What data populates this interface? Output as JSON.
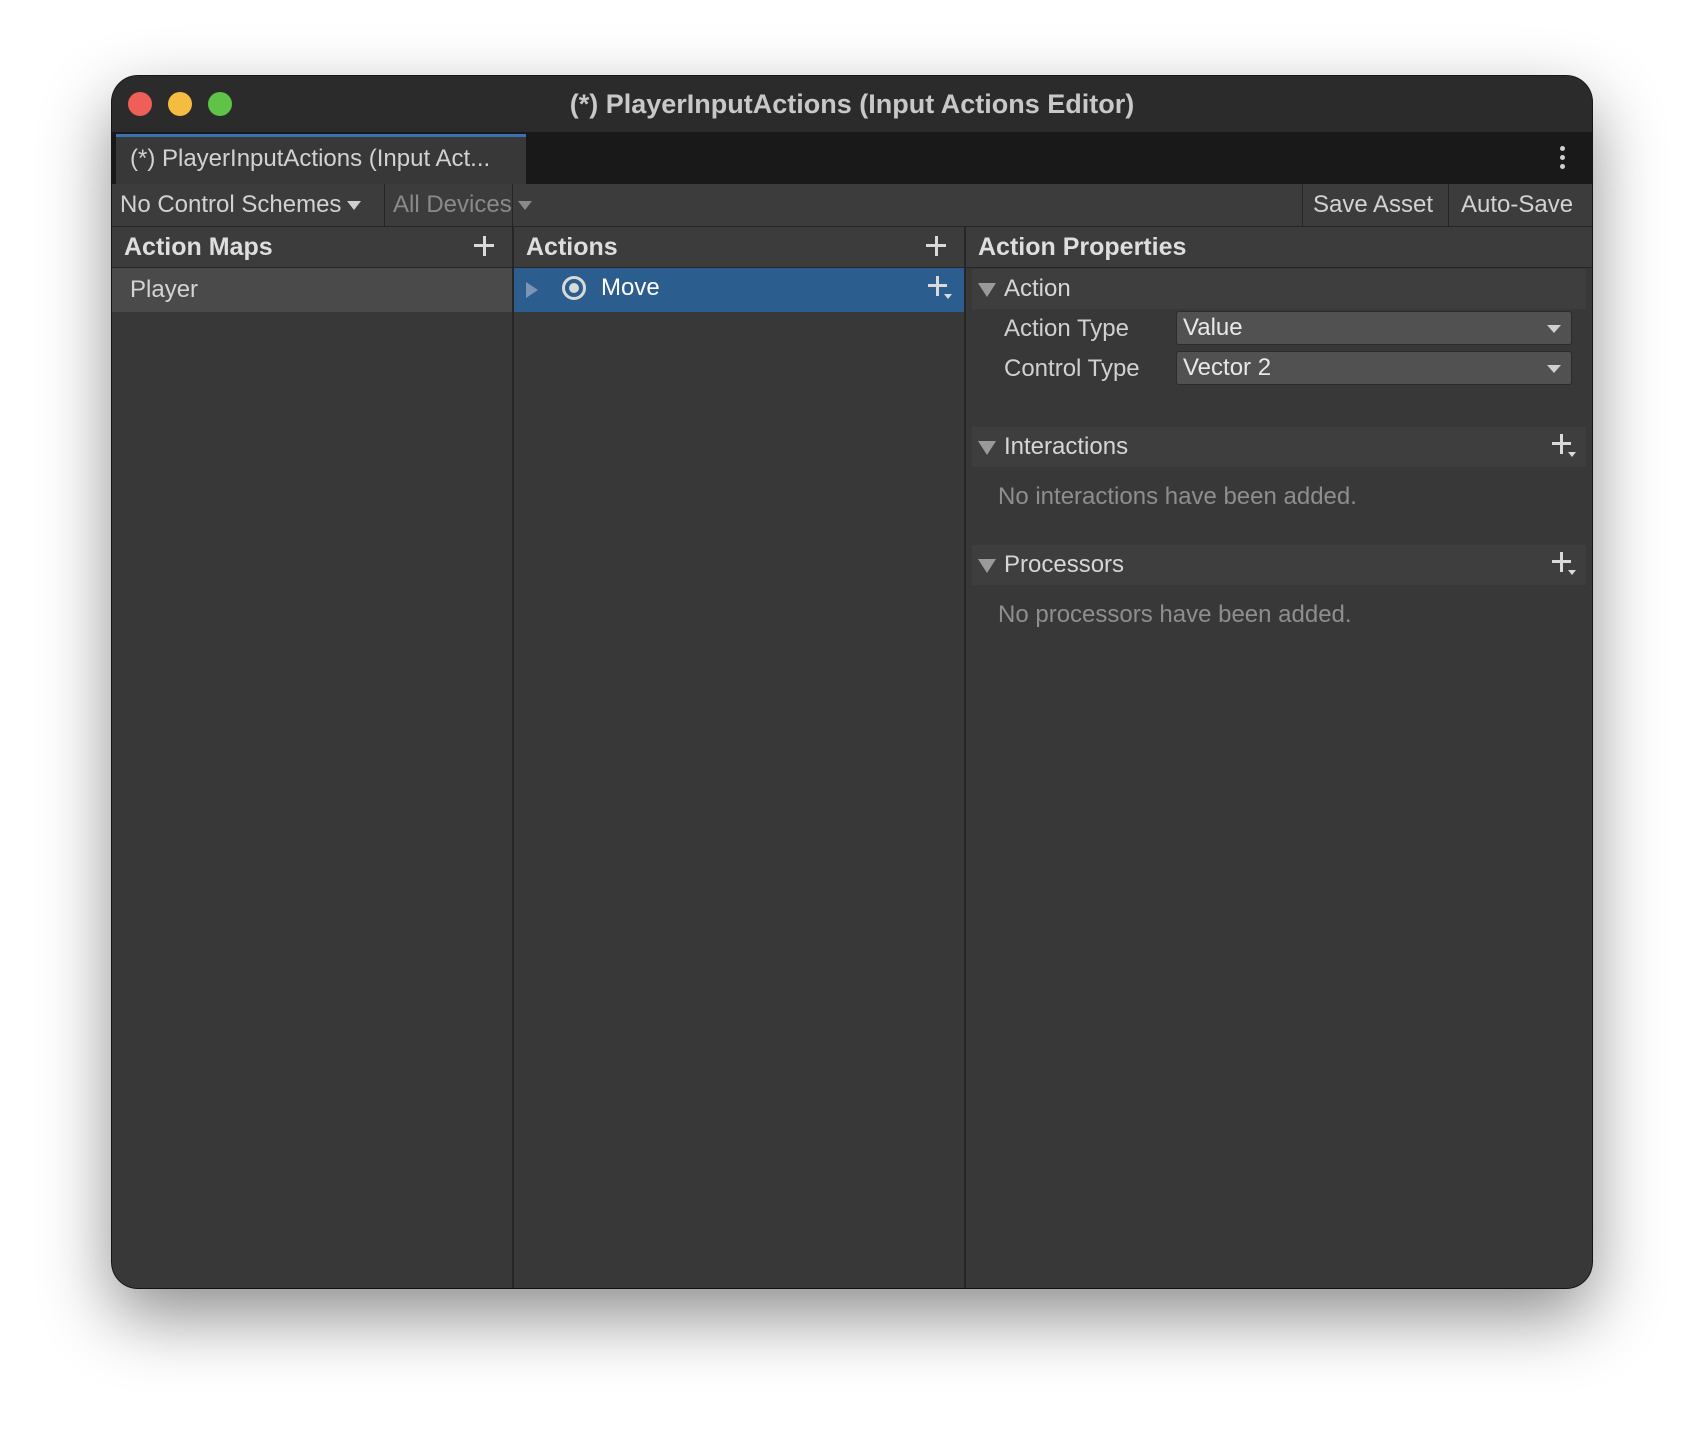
{
  "window": {
    "title": "(*) PlayerInputActions (Input Actions Editor)"
  },
  "tab": {
    "label": "(*) PlayerInputActions (Input Act..."
  },
  "toolbar": {
    "control_schemes": "No Control Schemes",
    "devices": "All Devices",
    "save_asset": "Save Asset",
    "auto_save": "Auto-Save"
  },
  "action_maps": {
    "header": "Action Maps",
    "items": [
      {
        "label": "Player"
      }
    ]
  },
  "actions": {
    "header": "Actions",
    "items": [
      {
        "label": "Move"
      }
    ]
  },
  "properties": {
    "header": "Action Properties",
    "action_section": "Action",
    "action_type_label": "Action Type",
    "action_type_value": "Value",
    "control_type_label": "Control Type",
    "control_type_value": "Vector 2",
    "interactions_section": "Interactions",
    "interactions_empty": "No interactions have been added.",
    "processors_section": "Processors",
    "processors_empty": "No processors have been added."
  },
  "colors": {
    "selection": "#2c5d8f",
    "tab_accent": "#3a72b0",
    "traffic_red": "#ee5f57",
    "traffic_yellow": "#f5bd40",
    "traffic_green": "#5ec346"
  }
}
